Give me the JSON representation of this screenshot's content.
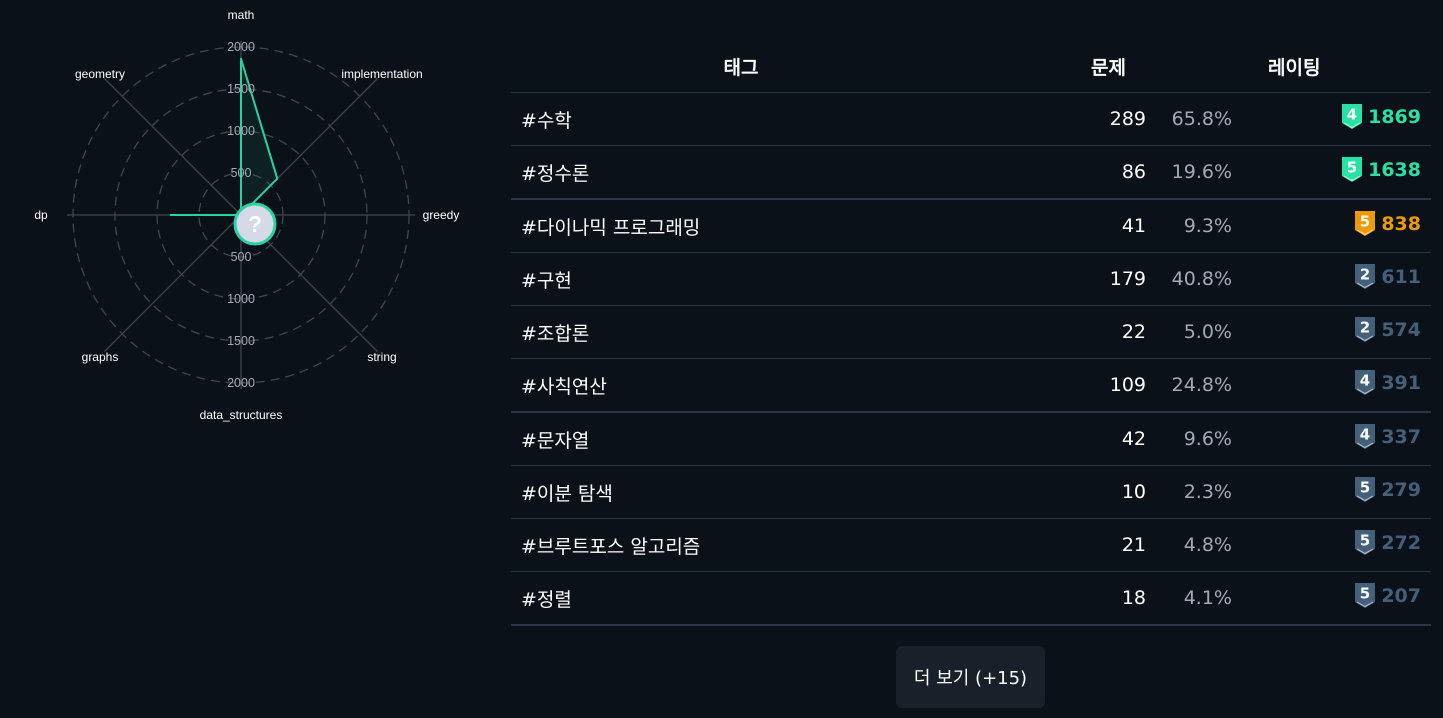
{
  "radar": {
    "axes": [
      {
        "label": "math",
        "value": 1860
      },
      {
        "label": "implementation",
        "value": 611
      },
      {
        "label": "greedy",
        "value": 0
      },
      {
        "label": "string",
        "value": 0
      },
      {
        "label": "data_structures",
        "value": 0
      },
      {
        "label": "graphs",
        "value": 0
      },
      {
        "label": "dp",
        "value": 838
      },
      {
        "label": "geometry",
        "value": 0
      }
    ],
    "max": 2000,
    "rings": [
      500,
      1000,
      1500,
      2000
    ],
    "ring_labels_top": [
      "500",
      "1000",
      "1500",
      "2000"
    ],
    "ring_labels_bottom": [
      "500",
      "1000",
      "1500",
      "2000"
    ],
    "center_badge_symbol": "?",
    "line_color": "#27d3a1",
    "grid_color": "#3e4651",
    "badge_fill": "#d6d9e8"
  },
  "table": {
    "headers": {
      "tag": "태그",
      "problems": "문제",
      "rating": "레이팅"
    },
    "rows": [
      {
        "tag": "#수학",
        "count": "289",
        "pct": "65.8%",
        "tier": "4",
        "rating": "1869",
        "tier_color": "#27e2a4"
      },
      {
        "tag": "#정수론",
        "count": "86",
        "pct": "19.6%",
        "tier": "5",
        "rating": "1638",
        "tier_color": "#27e2a4"
      },
      {
        "tag": "#다이나믹 프로그래밍",
        "count": "41",
        "pct": "9.3%",
        "tier": "5",
        "rating": "838",
        "tier_color": "#ec9a00"
      },
      {
        "tag": "#구현",
        "count": "179",
        "pct": "40.8%",
        "tier": "2",
        "rating": "611",
        "tier_color": "#435f7a"
      },
      {
        "tag": "#조합론",
        "count": "22",
        "pct": "5.0%",
        "tier": "2",
        "rating": "574",
        "tier_color": "#435f7a"
      },
      {
        "tag": "#사칙연산",
        "count": "109",
        "pct": "24.8%",
        "tier": "4",
        "rating": "391",
        "tier_color": "#435f7a"
      },
      {
        "tag": "#문자열",
        "count": "42",
        "pct": "9.6%",
        "tier": "4",
        "rating": "337",
        "tier_color": "#435f7a"
      },
      {
        "tag": "#이분 탐색",
        "count": "10",
        "pct": "2.3%",
        "tier": "5",
        "rating": "279",
        "tier_color": "#435f7a"
      },
      {
        "tag": "#브루트포스 알고리즘",
        "count": "21",
        "pct": "4.8%",
        "tier": "5",
        "rating": "272",
        "tier_color": "#435f7a"
      },
      {
        "tag": "#정렬",
        "count": "18",
        "pct": "4.1%",
        "tier": "5",
        "rating": "207",
        "tier_color": "#435f7a"
      }
    ]
  },
  "more_button": {
    "label": "더 보기 (+15)"
  }
}
